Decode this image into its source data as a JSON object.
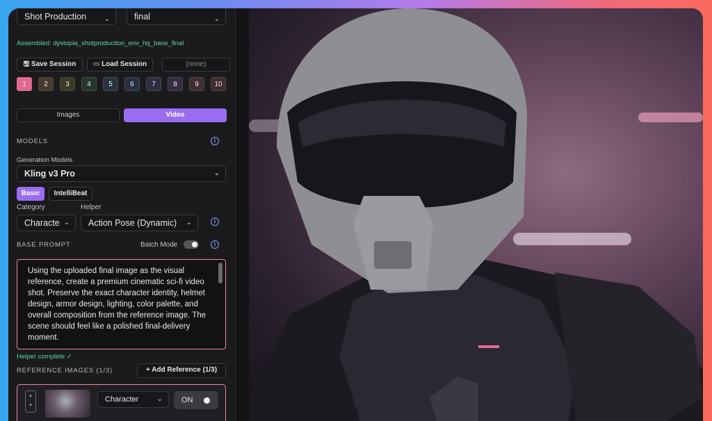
{
  "top_selects": {
    "left": "Shot Production",
    "right": "final"
  },
  "assembled": "Assembled: dystopia_shotproduction_env_hq_base_final",
  "session": {
    "save": "Save Session",
    "load": "Load Session",
    "current": "(none)"
  },
  "slots": [
    "1",
    "2",
    "3",
    "4",
    "5",
    "6",
    "7",
    "8",
    "9",
    "10"
  ],
  "slot_colors": [
    "#e06a8f",
    "#4a3a2c",
    "#3c3a24",
    "#26382c",
    "#263440",
    "#263040",
    "#2c2c42",
    "#362c42",
    "#422c36",
    "#422c2c"
  ],
  "mode_tabs": {
    "images": "Images",
    "video": "Video"
  },
  "models": {
    "section": "MODELS",
    "generation_label": "Generation Models",
    "selected": "Kling v3 Pro",
    "subtabs": {
      "basic": "Basic",
      "intellibeat": "IntelliBeat"
    }
  },
  "category": {
    "label": "Category",
    "value": "Characte"
  },
  "helper": {
    "label": "Helper",
    "value": "Action Pose (Dynamic)"
  },
  "base_prompt": {
    "section": "BASE PROMPT",
    "batch": "Batch Mode",
    "text": "Using the uploaded final image as the visual reference, create a premium cinematic sci-fi video shot. Preserve the exact character identity, helmet design, armor design, lighting, color palette, and overall composition from the reference image. The scene should feel like a polished final-delivery moment.",
    "status": "Helper complete ✓"
  },
  "reference": {
    "section": "REFERENCE IMAGES (1/3)",
    "add": "Add Reference (1/3)",
    "row_type": "Character",
    "row_toggle": "ON"
  },
  "colors": {
    "accent": "#9b6cf0",
    "pink": "#e06a8f",
    "status_green": "#5fd39a"
  }
}
